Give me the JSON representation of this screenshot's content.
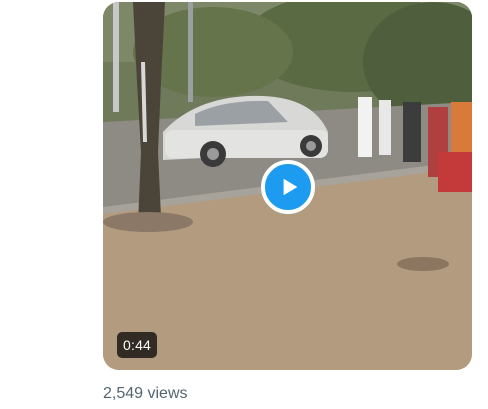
{
  "tweet": {
    "media": {
      "type": "video",
      "duration": "0:44",
      "play_icon": "play-icon",
      "play_button_color": "#1d9bf0"
    },
    "views_text": "2,549 views"
  }
}
